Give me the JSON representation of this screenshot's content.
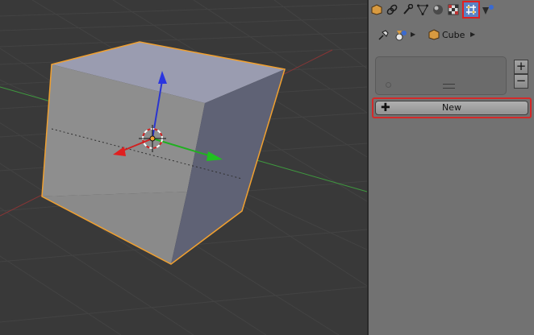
{
  "properties": {
    "tabs": [
      "object-tab",
      "constraints-tab",
      "modifiers-tab",
      "data-tab",
      "material-tab",
      "texture-tab",
      "physics-tab",
      "scene-tab"
    ],
    "active_tab": "physics-tab",
    "context_object": "Cube",
    "new_button_label": "New",
    "add_button_label": "+",
    "remove_button_label": "−"
  }
}
